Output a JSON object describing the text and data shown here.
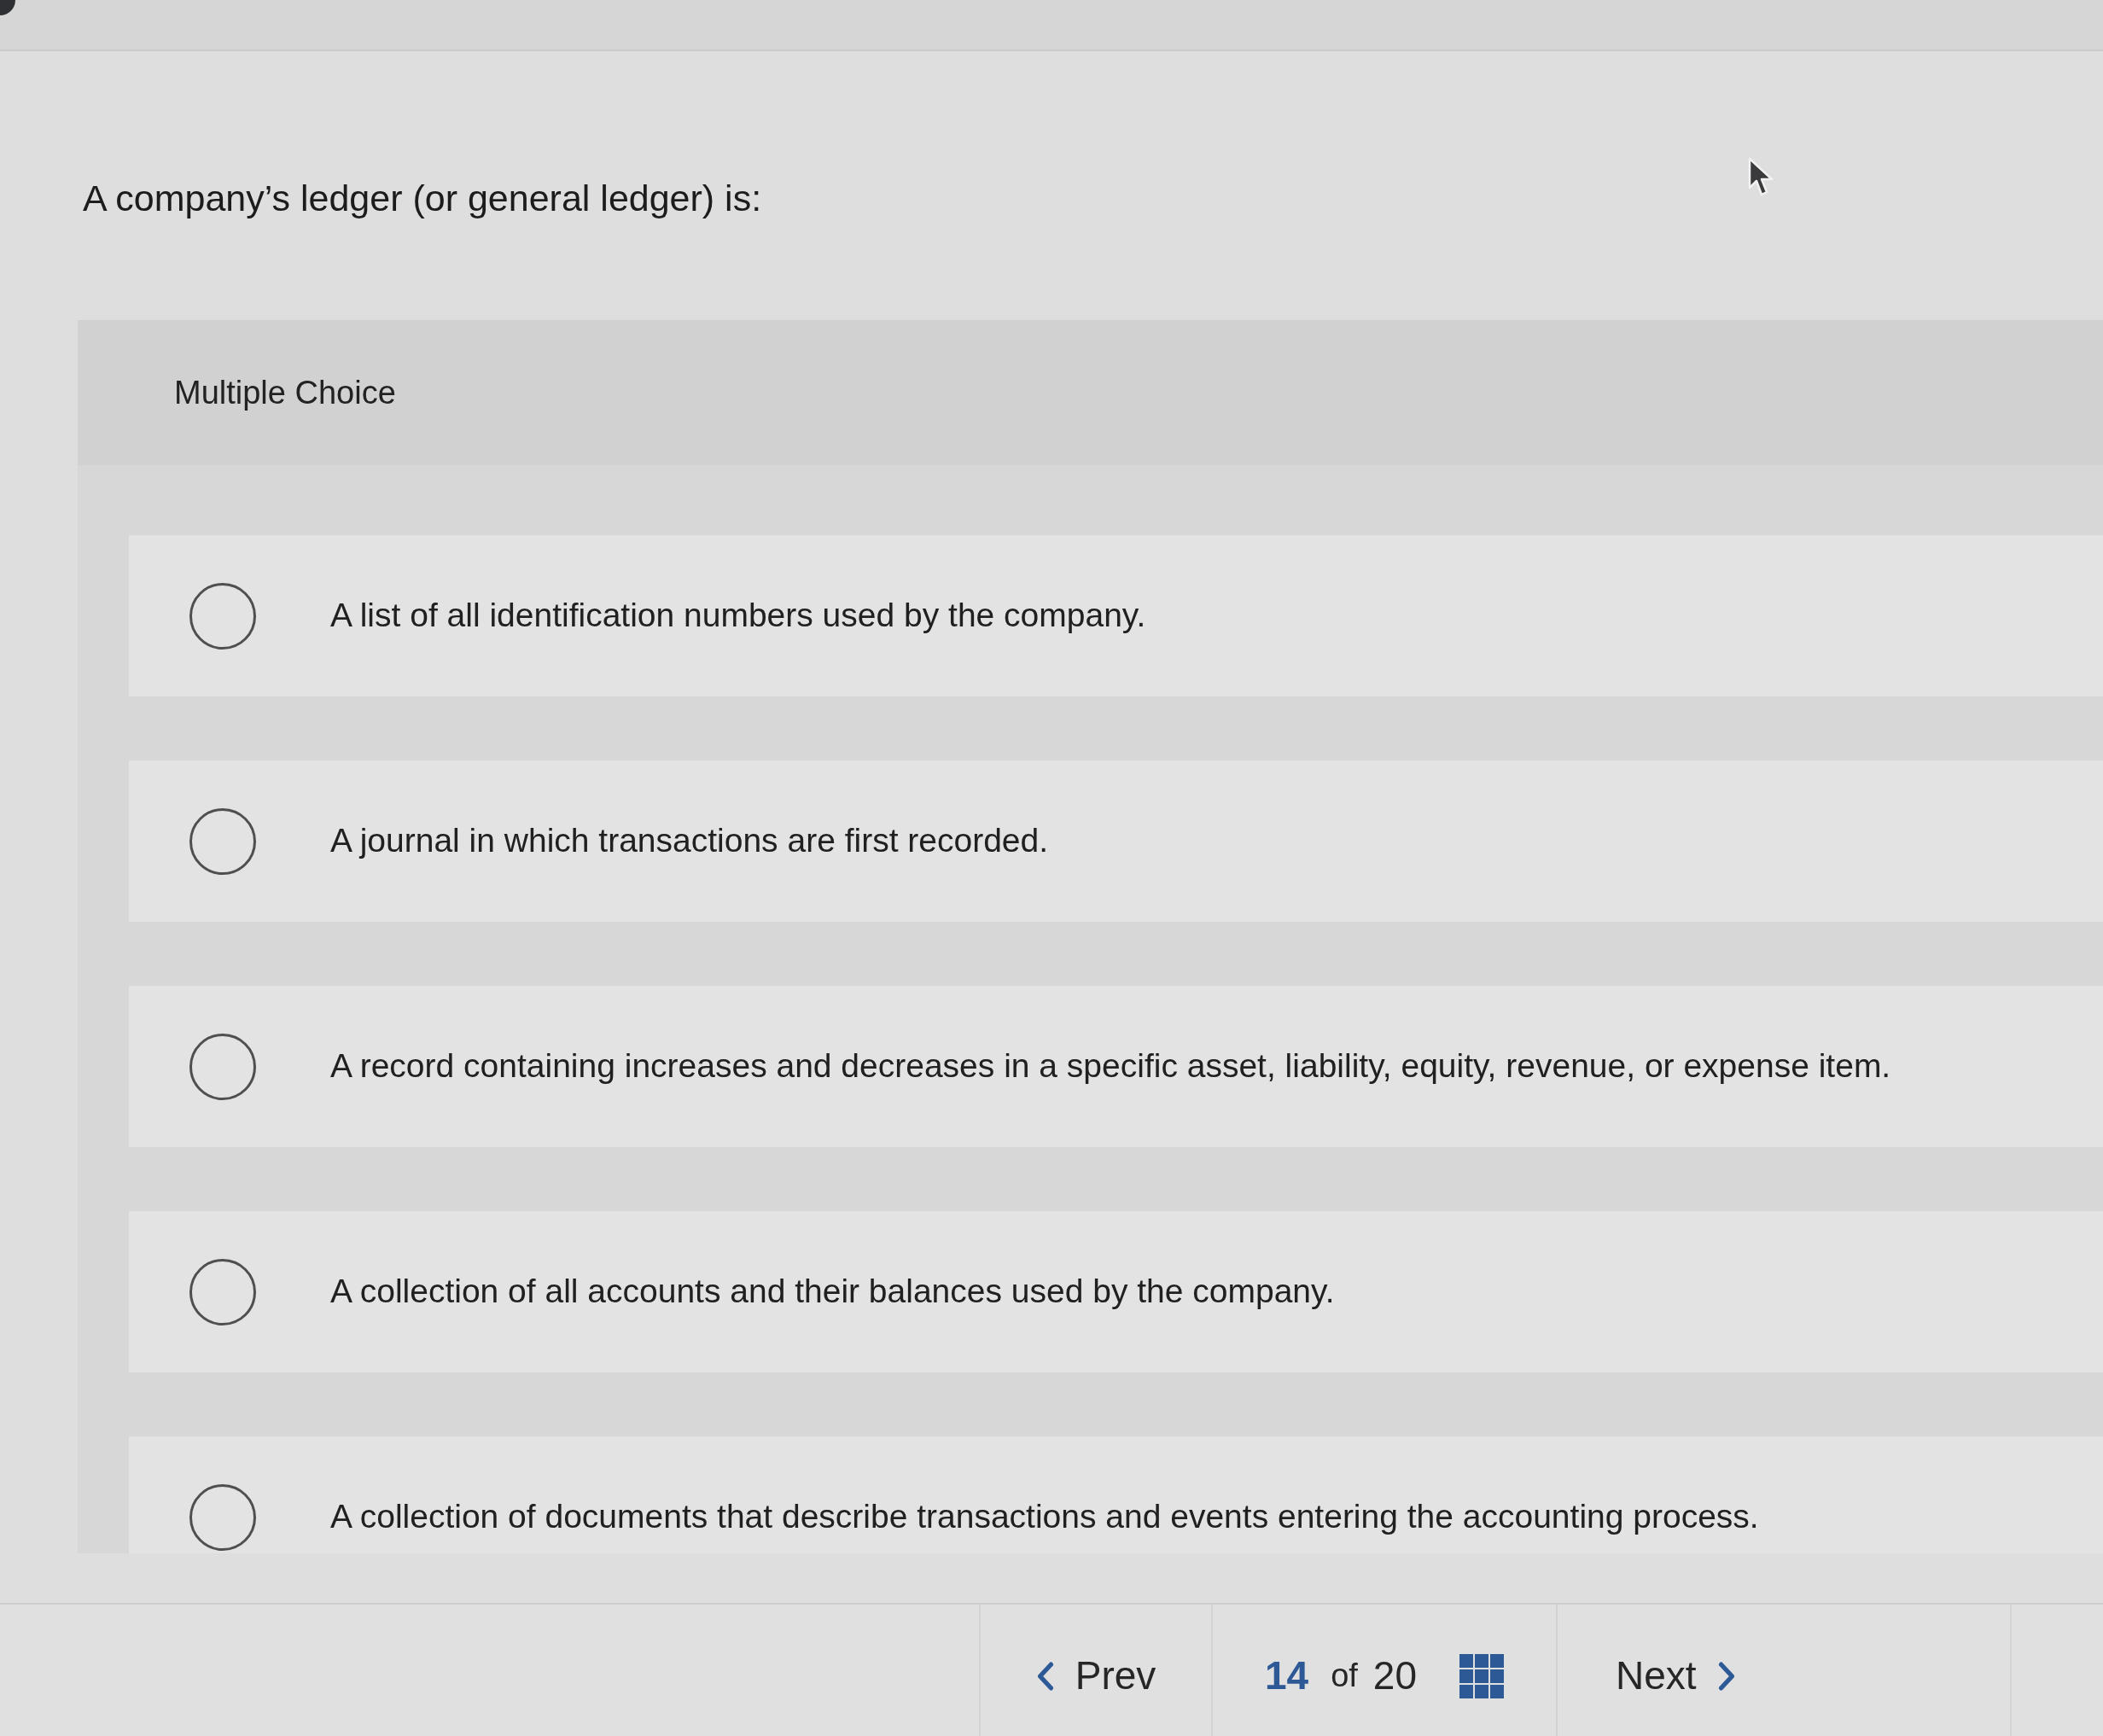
{
  "question": {
    "text": "A company’s ledger (or general ledger) is:"
  },
  "answer_panel": {
    "type_label": "Multiple Choice",
    "options": [
      {
        "text": "A list of all identification numbers used by the company.",
        "selected": false
      },
      {
        "text": "A journal in which transactions are first recorded.",
        "selected": false
      },
      {
        "text": "A record containing increases and decreases in a specific asset, liability, equity, revenue, or expense item.",
        "selected": false
      },
      {
        "text": "A collection of all accounts and their balances used by the company.",
        "selected": false
      },
      {
        "text": "A collection of documents that describe transactions and events entering the accounting process.",
        "selected": false
      }
    ]
  },
  "pagination": {
    "prev_label": "Prev",
    "current": "14",
    "of_label": "of",
    "total": "20",
    "next_label": "Next"
  }
}
